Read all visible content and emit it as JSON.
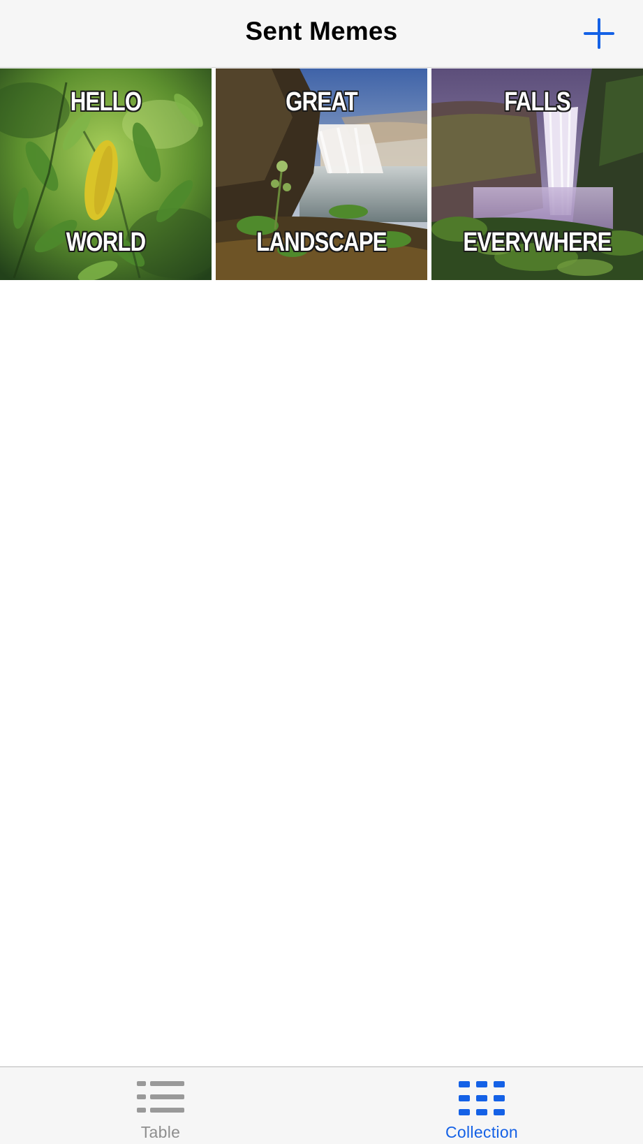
{
  "nav": {
    "title": "Sent Memes",
    "add_icon": "plus-icon"
  },
  "memes": [
    {
      "top": "HELLO",
      "bottom": "WORLD",
      "image": "green-leaves-photo"
    },
    {
      "top": "GREAT",
      "bottom": "LANDSCAPE",
      "image": "waterfall-cliff-photo"
    },
    {
      "top": "FALLS",
      "bottom": "EVERYWHERE",
      "image": "purple-waterfall-photo"
    }
  ],
  "tabs": [
    {
      "label": "Table",
      "icon": "list-icon",
      "selected": false
    },
    {
      "label": "Collection",
      "icon": "grid-icon",
      "selected": true
    }
  ],
  "colors": {
    "accent": "#1461e6",
    "inactive": "#8e8e8e",
    "bar_background": "#f6f6f6"
  }
}
